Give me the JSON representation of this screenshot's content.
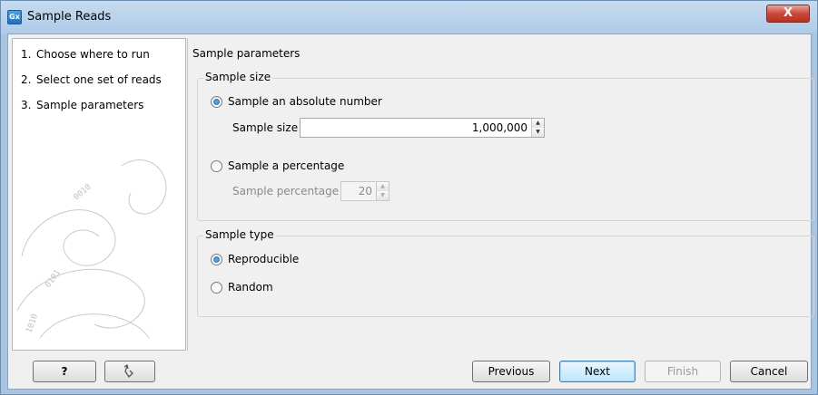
{
  "window": {
    "title": "Sample Reads",
    "app_icon_text": "Gx",
    "close_glyph": "X"
  },
  "steps": [
    {
      "num": "1.",
      "label": "Choose where to run"
    },
    {
      "num": "2.",
      "label": "Select one set of reads"
    },
    {
      "num": "3.",
      "label": "Sample parameters"
    }
  ],
  "main": {
    "section_title": "Sample parameters",
    "sample_size_group": {
      "legend": "Sample size",
      "absolute_option": "Sample an absolute number",
      "absolute_checked": true,
      "size_label": "Sample size",
      "size_value": "1,000,000",
      "percentage_option": "Sample a percentage",
      "percentage_checked": false,
      "percentage_label": "Sample percentage",
      "percentage_value": "20"
    },
    "sample_type_group": {
      "legend": "Sample type",
      "reproducible_option": "Reproducible",
      "reproducible_checked": true,
      "random_option": "Random",
      "random_checked": false
    }
  },
  "buttons": {
    "help": "?",
    "reset_icon": "reset-arrow-icon",
    "previous": "Previous",
    "next": "Next",
    "finish": "Finish",
    "cancel": "Cancel"
  }
}
